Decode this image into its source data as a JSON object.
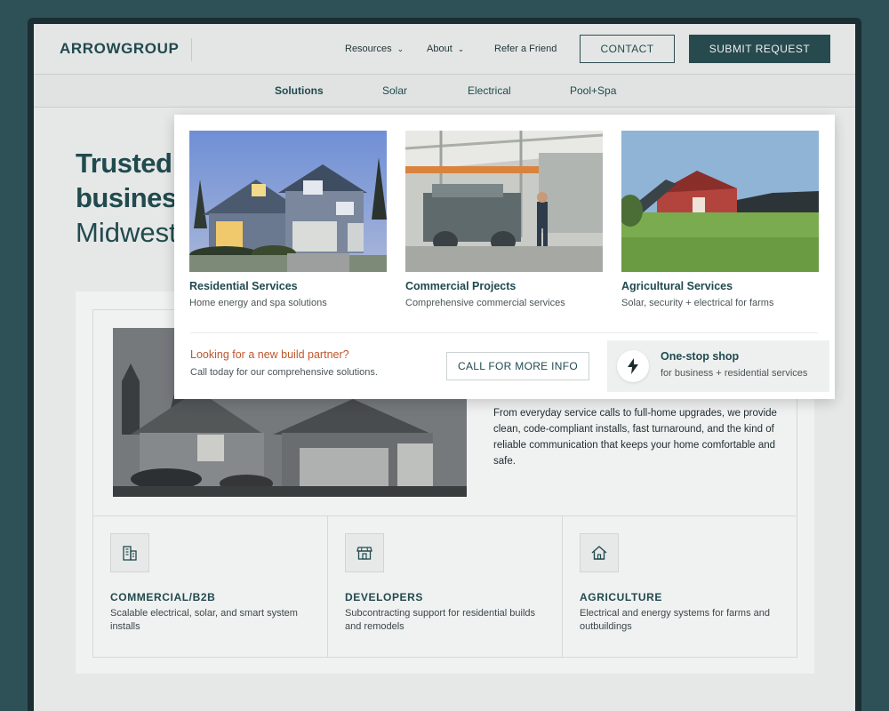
{
  "header": {
    "logo": "ARROWGROUP",
    "nav": [
      {
        "label": "Resources",
        "has_dropdown": true
      },
      {
        "label": "About",
        "has_dropdown": true
      },
      {
        "label": "Refer a Friend",
        "has_dropdown": false
      }
    ],
    "contact_label": "CONTACT",
    "submit_label": "SUBMIT REQUEST"
  },
  "subnav": {
    "items": [
      {
        "label": "Solutions",
        "active": true
      },
      {
        "label": "Solar",
        "active": false
      },
      {
        "label": "Electrical",
        "active": false
      },
      {
        "label": "Pool+Spa",
        "active": false
      }
    ]
  },
  "hero": {
    "line1": "Trusted",
    "line2": "business",
    "line3": "Midwest"
  },
  "mega_menu": {
    "cards": [
      {
        "title": "Residential Services",
        "subtitle": "Home energy and spa solutions",
        "image": "house-at-dusk-photo"
      },
      {
        "title": "Commercial Projects",
        "subtitle": "Comprehensive commercial services",
        "image": "warehouse-workers-photo"
      },
      {
        "title": "Agricultural Services",
        "subtitle": "Solar, security + electrical for farms",
        "image": "barn-solar-field-photo"
      }
    ],
    "cta": {
      "title": "Looking for a new build partner?",
      "subtitle": "Call today for our comprehensive solutions.",
      "button": "CALL FOR MORE INFO"
    },
    "shop": {
      "icon": "lightning-bolt-icon",
      "title": "One-stop shop",
      "subtitle": "for business + residential services"
    }
  },
  "content": {
    "description": "From everyday service calls to full-home upgrades, we provide clean, code-compliant installs, fast turnaround, and the kind of reliable communication that keeps your home comfortable and safe.",
    "columns": [
      {
        "icon": "building-icon",
        "title": "COMMERCIAL/B2B",
        "desc": "Scalable electrical, solar, and smart system installs"
      },
      {
        "icon": "storefront-icon",
        "title": "DEVELOPERS",
        "desc": "Subcontracting support for residential builds and remodels"
      },
      {
        "icon": "house-icon",
        "title": "AGRICULTURE",
        "desc": "Electrical and energy systems for farms and outbuildings"
      }
    ]
  },
  "colors": {
    "brand": "#1f4a4f",
    "background": "#2d5157",
    "accent": "#c0562c",
    "button_dark": "#254a50"
  }
}
